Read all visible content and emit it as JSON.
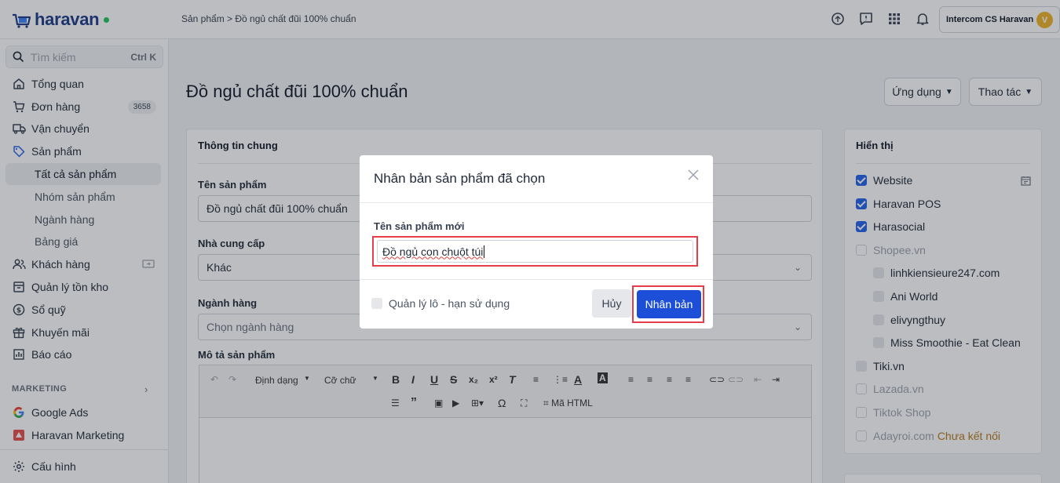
{
  "app": {
    "brand": "haravan",
    "colors": {
      "brand": "#1e3a8a",
      "primary": "#1d4ed8",
      "highlight": "#e53e4a",
      "online": "#22c55e"
    }
  },
  "topbar": {
    "breadcrumb": "Sản phẩm > Đồ ngủ chất đũi 100% chuẩn",
    "icons": [
      "support-icon",
      "chat-icon",
      "apps-grid-icon",
      "bell-icon"
    ],
    "account_name": "Intercom CS Haravan",
    "avatar_initial": "V"
  },
  "sidebar": {
    "search_placeholder": "Tìm kiếm",
    "search_shortcut": "Ctrl K",
    "items": [
      {
        "label": "Tổng quan",
        "icon": "home-icon"
      },
      {
        "label": "Đơn hàng",
        "icon": "cart-icon",
        "badge": "3658"
      },
      {
        "label": "Vận chuyển",
        "icon": "truck-icon"
      },
      {
        "label": "Sản phẩm",
        "icon": "tag-icon"
      }
    ],
    "sub_items": [
      "Tất cả sản phẩm",
      "Nhóm sản phẩm",
      "Ngành hàng",
      "Bảng giá"
    ],
    "items2": [
      {
        "label": "Khách hàng",
        "icon": "users-icon"
      },
      {
        "label": "Quản lý tồn kho",
        "icon": "inventory-icon"
      },
      {
        "label": "Sổ quỹ",
        "icon": "dollar-icon"
      },
      {
        "label": "Khuyến mãi",
        "icon": "gift-icon"
      },
      {
        "label": "Báo cáo",
        "icon": "report-icon"
      }
    ],
    "marketing_label": "MARKETING",
    "marketing_items": [
      {
        "label": "Google Ads",
        "icon": "google-icon"
      },
      {
        "label": "Haravan Marketing",
        "icon": "haravan-marketing-icon"
      }
    ],
    "settings_label": "Cấu hình"
  },
  "page": {
    "title": "Đồ ngủ chất đũi 100% chuẩn",
    "apps_button": "Ứng dụng",
    "actions_button": "Thao tác",
    "general": {
      "title": "Thông tin chung",
      "name_label": "Tên sản phẩm",
      "name_value": "Đồ ngủ chất đũi 100% chuẩn",
      "vendor_label": "Nhà cung cấp",
      "vendor_value": "Khác",
      "category_label": "Ngành hàng",
      "category_placeholder": "Chọn ngành hàng",
      "desc_label": "Mô tả sản phẩm",
      "toolbar": {
        "format": "Định dạng",
        "size": "Cỡ chữ",
        "html": "Mã HTML"
      }
    },
    "visibility": {
      "title": "Hiển thị",
      "channels": [
        {
          "label": "Website",
          "state": "on"
        },
        {
          "label": "Haravan POS",
          "state": "on"
        },
        {
          "label": "Harasocial",
          "state": "on"
        },
        {
          "label": "Shopee.vn",
          "state": "off",
          "muted": true
        },
        {
          "label": "linhkiensieure247.com",
          "state": "grey",
          "sub": true
        },
        {
          "label": "Ani World",
          "state": "grey",
          "sub": true
        },
        {
          "label": "elivyngthuy",
          "state": "grey",
          "sub": true
        },
        {
          "label": "Miss Smoothie - Eat Clean",
          "state": "grey",
          "sub": true
        },
        {
          "label": "Tiki.vn",
          "state": "grey"
        },
        {
          "label": "Lazada.vn",
          "state": "off",
          "muted": true
        },
        {
          "label": "Tiktok Shop",
          "state": "off",
          "muted": true
        },
        {
          "label": "Adayroi.com",
          "state": "off",
          "muted": true,
          "status": "Chưa kết nối"
        }
      ]
    }
  },
  "modal": {
    "title": "Nhân bản sản phẩm đã chọn",
    "field_label": "Tên sản phẩm mới",
    "field_value": "Đồ ngủ con chuột túi",
    "checkbox_label": "Quản lý lô - hạn sử dụng",
    "cancel_label": "Hủy",
    "confirm_label": "Nhân bản"
  }
}
